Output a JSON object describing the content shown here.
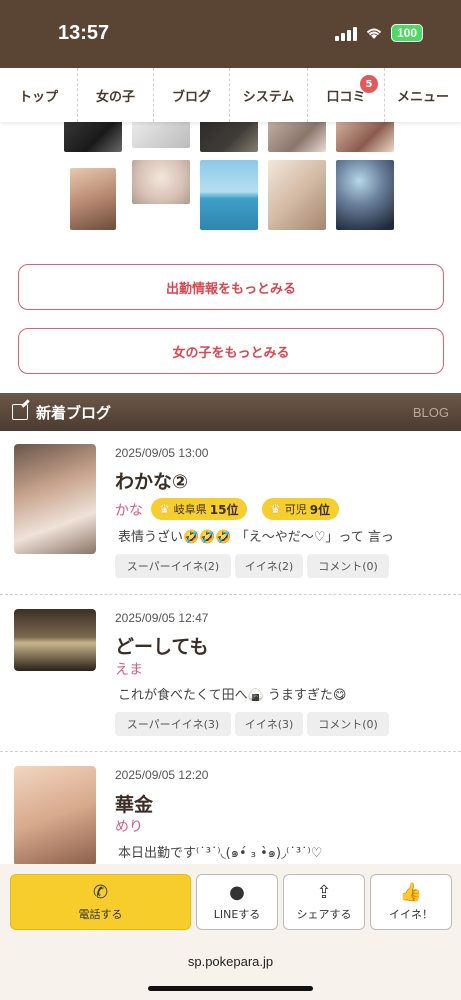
{
  "status_bar": {
    "time": "13:57",
    "battery": "100"
  },
  "nav": {
    "items": [
      {
        "label": "トップ"
      },
      {
        "label": "女の子"
      },
      {
        "label": "ブログ"
      },
      {
        "label": "システム"
      },
      {
        "label": "口コミ",
        "badge": "5"
      },
      {
        "label": "メニュー"
      }
    ]
  },
  "buttons": {
    "more_schedule": "出勤情報をもっとみる",
    "more_girls": "女の子をもっとみる"
  },
  "blog_section": {
    "title": "新着ブログ",
    "label_en": "BLOG"
  },
  "blog_entries": [
    {
      "date": "2025/09/05 13:00",
      "title": "わかな②",
      "author": "かな",
      "ranks": [
        {
          "area": "岐阜県",
          "rank": "15位"
        },
        {
          "area": "可児",
          "rank": "9位"
        }
      ],
      "excerpt": "表情うざい🤣🤣🤣 「え〜やだ〜♡」って 言っ",
      "tags": [
        "スーパーイイネ(2)",
        "イイネ(2)",
        "コメント(0)"
      ]
    },
    {
      "date": "2025/09/05 12:47",
      "title": "どーしても",
      "author": "えま",
      "excerpt": "これが食べたくて田へ🍙 うますぎた😋",
      "tags": [
        "スーパーイイネ(3)",
        "イイネ(3)",
        "コメント(0)"
      ]
    },
    {
      "date": "2025/09/05 12:20",
      "title": "華金",
      "author": "めり",
      "excerpt": "本日出勤です⁽˙³˙⁾◟(๑•́ ₃ •̀๑)◞⁽˙³˙⁾♡"
    }
  ],
  "action_bar": {
    "call": "電話する",
    "line": "LINEする",
    "share": "シェアする",
    "like": "イイネ！"
  },
  "browser": {
    "url": "sp.pokepara.jp"
  },
  "colors": {
    "brand_brown": "#5a4535",
    "accent_pink": "#d9474f",
    "badge_yellow": "#f6cf2f"
  }
}
